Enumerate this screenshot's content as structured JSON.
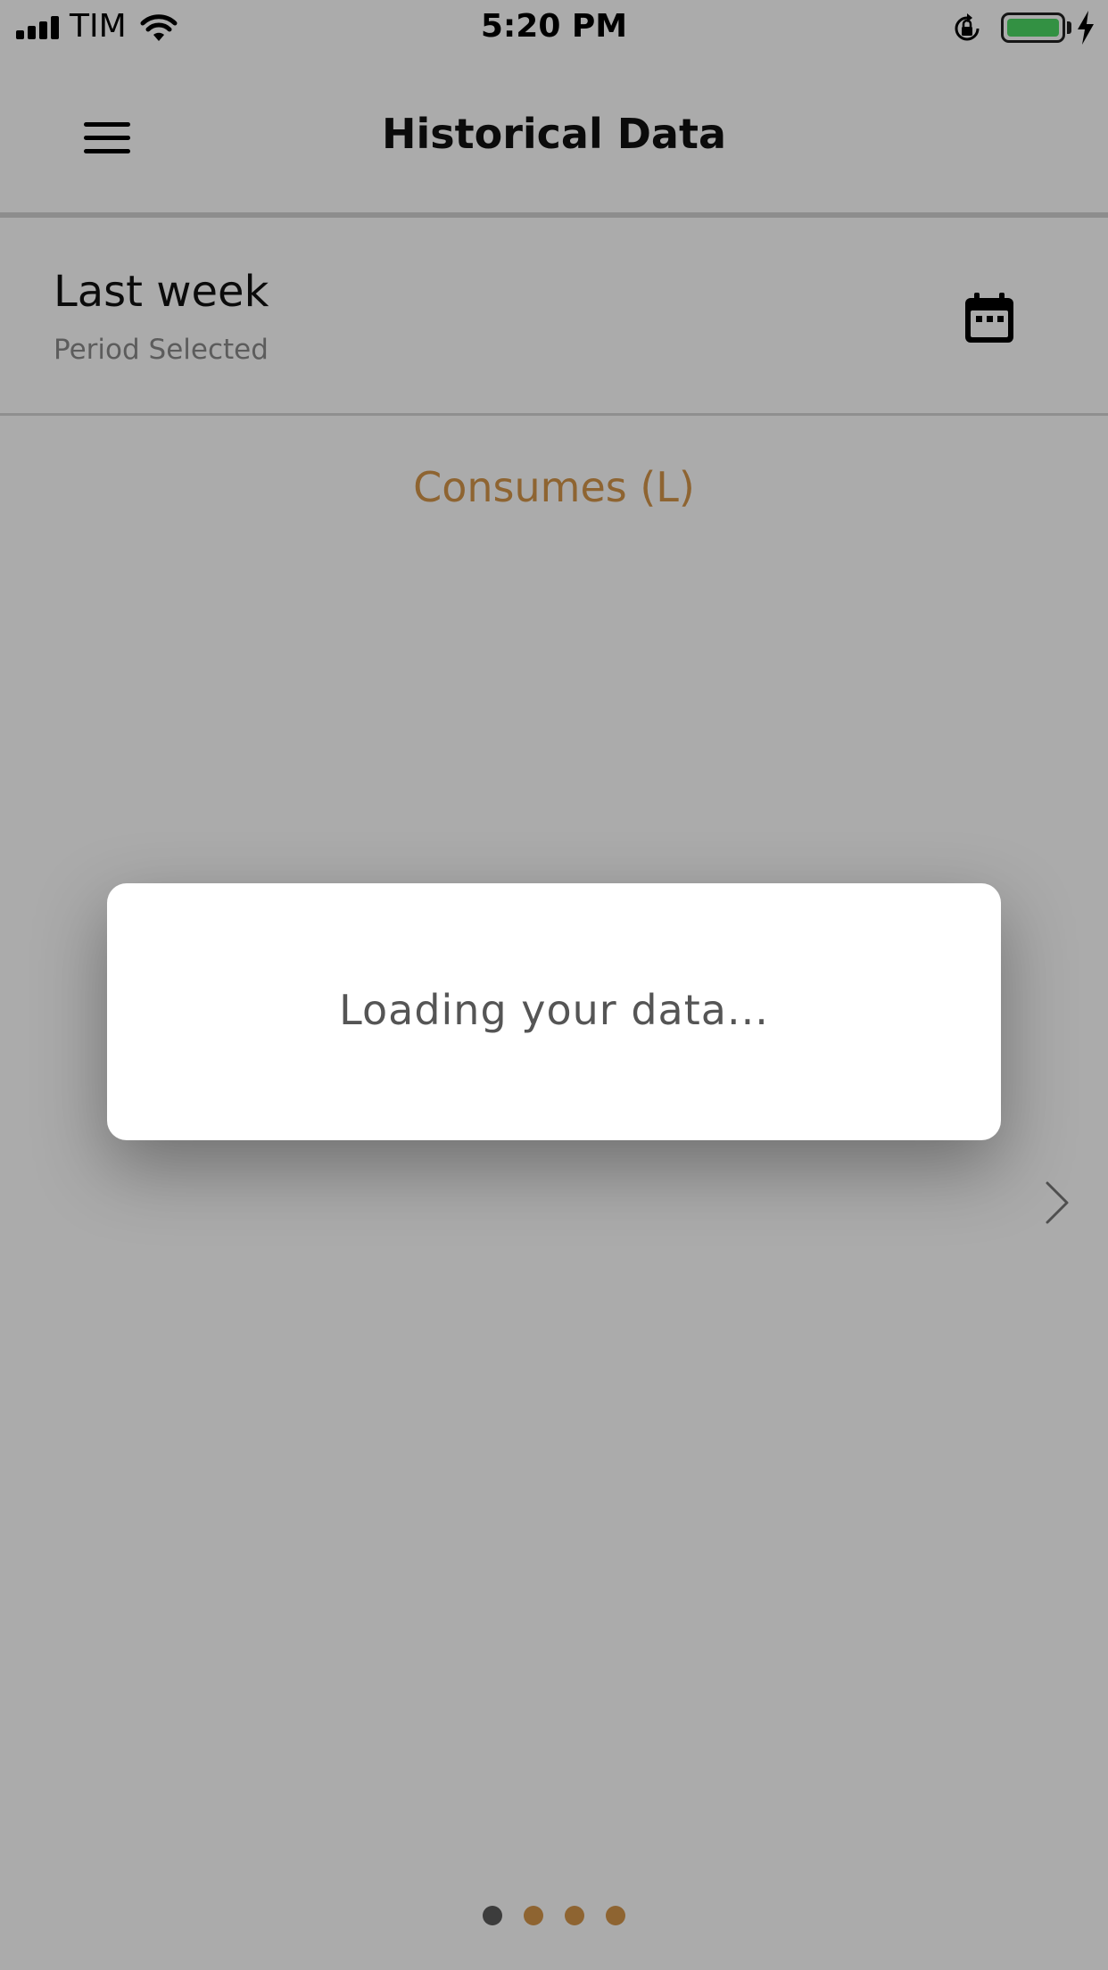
{
  "status_bar": {
    "carrier": "TIM",
    "time": "5:20 PM",
    "battery_level": 1.0,
    "battery_color": "#4cd964",
    "icons": [
      "signal-icon",
      "wifi-icon",
      "orientation-lock-icon",
      "battery-icon",
      "charging-bolt-icon"
    ]
  },
  "header": {
    "title": "Historical Data",
    "menu_icon": "hamburger-menu-icon"
  },
  "period": {
    "value": "Last week",
    "label": "Period Selected",
    "icon": "calendar-icon"
  },
  "section": {
    "title": "Consumes (L)",
    "accent_color": "#d4954a"
  },
  "navigation": {
    "next_icon": "chevron-right-icon",
    "pages_total": 4,
    "active_page": 1,
    "active_dot_color": "#5a5a5a",
    "inactive_dot_color": "#d4954a"
  },
  "dialog": {
    "message": "Loading your data..."
  }
}
